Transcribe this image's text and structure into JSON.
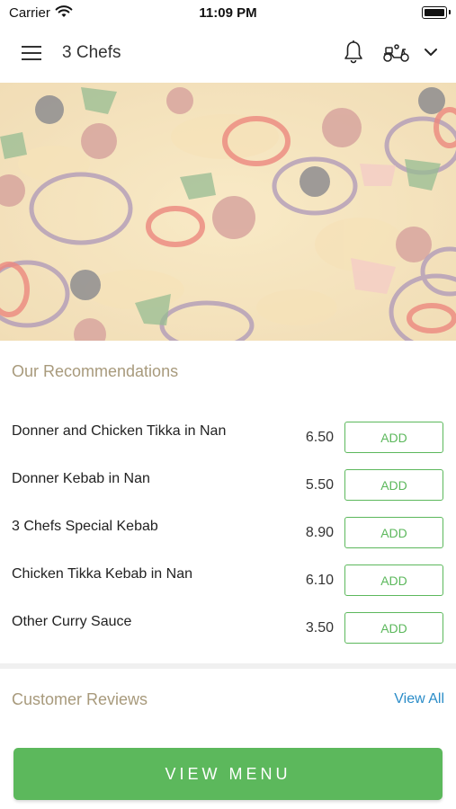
{
  "status_bar": {
    "carrier": "Carrier",
    "time": "11:09 PM"
  },
  "nav": {
    "title": "3 Chefs",
    "icons": [
      "menu-icon",
      "bell-icon",
      "scooter-icon",
      "chevron-down-icon"
    ]
  },
  "hero": {
    "image": "pizza"
  },
  "recommendations": {
    "title": "Our Recommendations",
    "items": [
      {
        "name": "Donner and Chicken Tikka in Nan",
        "price": "6.50",
        "action": "ADD"
      },
      {
        "name": "Donner Kebab in Nan",
        "price": "5.50",
        "action": "ADD"
      },
      {
        "name": "3 Chefs Special Kebab",
        "price": "8.90",
        "action": "ADD"
      },
      {
        "name": "Chicken Tikka Kebab in Nan",
        "price": "6.10",
        "action": "ADD"
      },
      {
        "name": "Other Curry Sauce",
        "price": "3.50",
        "action": "ADD"
      }
    ]
  },
  "reviews": {
    "title": "Customer Reviews",
    "view_all": "View All"
  },
  "footer": {
    "view_menu": "VIEW MENU"
  },
  "colors": {
    "accent_green": "#5cb85c",
    "section_title": "#a89a7c",
    "link_blue": "#2a8cc8"
  }
}
